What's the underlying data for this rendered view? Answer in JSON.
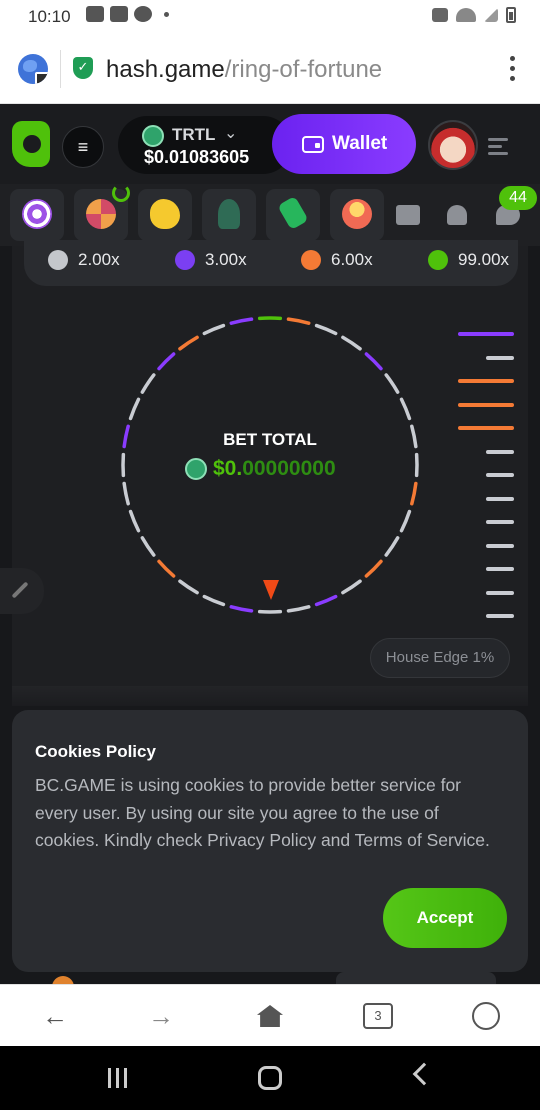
{
  "statusbar": {
    "time": "10:10"
  },
  "browser": {
    "url_host": "hash.game",
    "url_path": "/ring-of-fortune",
    "tab_count": "3"
  },
  "header": {
    "currency": "TRTL",
    "balance": "$0.01083605",
    "wallet_label": "Wallet"
  },
  "games_bar": {
    "tiles": [
      "dart-game-icon",
      "wheel-game-icon",
      "piggy-bank-icon",
      "rocket-game-icon",
      "cash-tag-icon",
      "jackpot-pot-icon"
    ],
    "notification_count": "44"
  },
  "game": {
    "payouts": [
      {
        "multiplier": "2.00x",
        "color": "#c4c7cc"
      },
      {
        "multiplier": "3.00x",
        "color": "#7b3ff2"
      },
      {
        "multiplier": "6.00x",
        "color": "#f47a35"
      },
      {
        "multiplier": "99.00x",
        "color": "#4fc10b"
      }
    ],
    "bet_total_label": "BET TOTAL",
    "bet_total_prefix": "$0.",
    "bet_total_zeros": "00000000",
    "house_edge": "House Edge 1%",
    "ring_colors": {
      "grey": "#c9ccd2",
      "purple": "#8a3cff",
      "orange": "#f47a35",
      "green": "#4fc10b"
    },
    "side_ticks": [
      "purple",
      "grey",
      "orange",
      "orange",
      "orange",
      "grey",
      "grey",
      "grey",
      "grey",
      "grey",
      "grey",
      "grey",
      "grey"
    ]
  },
  "cookies": {
    "title": "Cookies Policy",
    "text": "BC.GAME is using cookies to provide better service for every user. By using our site you agree to the use of cookies. Kindly check Privacy Policy and Terms of Service.",
    "accept_label": "Accept"
  }
}
